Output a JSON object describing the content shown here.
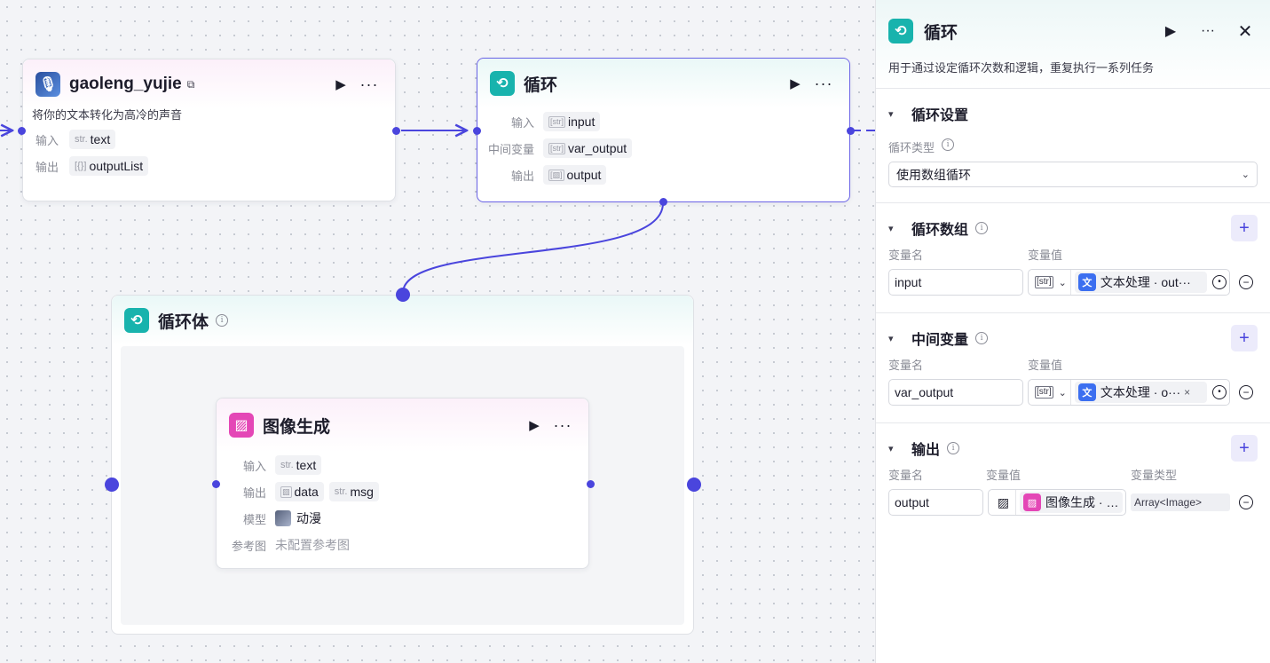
{
  "canvas": {
    "node_tts": {
      "title": "gaoleng_yujie",
      "description": "将你的文本转化为高冷的声音",
      "input_label": "输入",
      "input_type": "str.",
      "input_value": "text",
      "output_label": "输出",
      "output_type": "[{}]",
      "output_value": "outputList"
    },
    "node_loop": {
      "title": "循环",
      "input_label": "输入",
      "input_type": "[str]",
      "input_value": "input",
      "mid_label": "中间变量",
      "mid_type": "[str]",
      "mid_value": "var_output",
      "output_label": "输出",
      "output_type": "[▨]",
      "output_value": "output"
    },
    "loop_body": {
      "title": "循环体"
    },
    "node_image": {
      "title": "图像生成",
      "input_label": "输入",
      "input_type": "str.",
      "input_value": "text",
      "output_label": "输出",
      "output_value_1": "data",
      "output_type_2": "str.",
      "output_value_2": "msg",
      "model_label": "模型",
      "model_value": "动漫",
      "ref_label": "参考图",
      "ref_value": "未配置参考图"
    }
  },
  "panel": {
    "title": "循环",
    "description": "用于通过设定循环次数和逻辑，重复执行一系列任务",
    "loop_settings": {
      "title": "循环设置",
      "type_label": "循环类型",
      "type_value": "使用数组循环"
    },
    "loop_array": {
      "title": "循环数组",
      "col_name": "变量名",
      "col_value": "变量值",
      "var_name": "input",
      "var_type": "[str]",
      "var_ref": "文本处理 · out···"
    },
    "intermediate": {
      "title": "中间变量",
      "col_name": "变量名",
      "col_value": "变量值",
      "var_name": "var_output",
      "var_type": "[str]",
      "var_ref": "文本处理 · o···"
    },
    "output": {
      "title": "输出",
      "col_name": "变量名",
      "col_value": "变量值",
      "col_type": "变量类型",
      "var_name": "output",
      "var_ref": "图像生成 · d···",
      "var_type": "Array<Image>"
    }
  },
  "colors": {
    "accent": "#4a45dd",
    "teal": "#18b3ad",
    "pink": "#e447b6",
    "blue": "#3c6ff0"
  }
}
